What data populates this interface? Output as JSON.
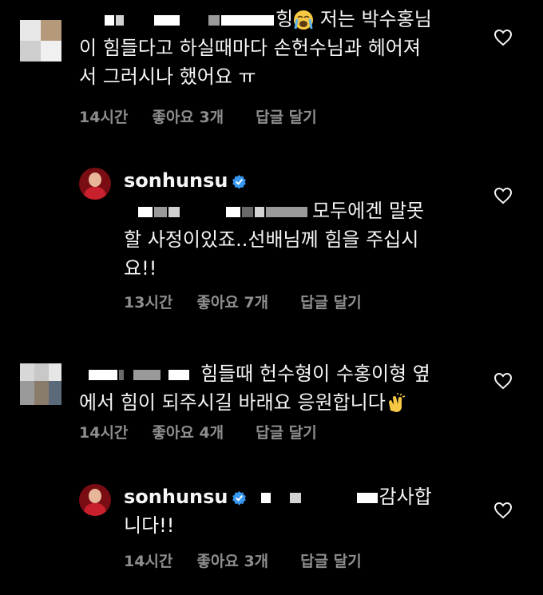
{
  "comments": [
    {
      "lines": [
        "힝",
        "이 힘들다고 하실때마다 손헌수님과 헤어져",
        "서 그러시나 했어요 ㅠ"
      ],
      "time": "14시간",
      "likes": "좋아요 3개",
      "reply": "답글 달기"
    },
    {
      "username": "sonhunsu",
      "lines": [
        "모두에겐 말못",
        "할 사정이있죠..선배님께 힘을 주십시",
        "요!!"
      ],
      "time": "13시간",
      "likes": "좋아요 7개",
      "reply": "답글 달기"
    },
    {
      "lines": [
        "힘들때 헌수형이 수홍이형 옆",
        "에서 힘이 되주시길 바래요 응원합니다"
      ],
      "time": "14시간",
      "likes": "좋아요 4개",
      "reply": "답글 달기"
    },
    {
      "username": "sonhunsu",
      "lines": [
        "감사합",
        "니다!!"
      ],
      "time": "14시간",
      "likes": "좋아요 3개",
      "reply": "답글 달기"
    }
  ],
  "icons": {
    "heart": "heart-outline-icon",
    "verified": "verified-badge-icon",
    "crying": "loudly-crying-face-emoji",
    "clap": "clapping-hands-emoji"
  },
  "colors": {
    "background": "#000000",
    "text": "#f5f5f5",
    "meta": "#8e8e8e",
    "verified": "#3897f0"
  }
}
